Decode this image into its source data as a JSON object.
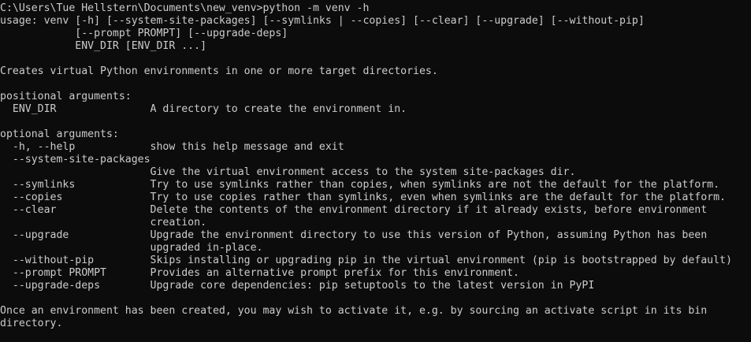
{
  "terminal": {
    "background": "#0c0c0c",
    "foreground": "#cccccc",
    "lines": [
      "C:\\Users\\Tue Hellstern\\Documents\\new_venv>python -m venv -h",
      "usage: venv [-h] [--system-site-packages] [--symlinks | --copies] [--clear] [--upgrade] [--without-pip]",
      "            [--prompt PROMPT] [--upgrade-deps]",
      "            ENV_DIR [ENV_DIR ...]",
      "",
      "Creates virtual Python environments in one or more target directories.",
      "",
      "positional arguments:",
      "  ENV_DIR               A directory to create the environment in.",
      "",
      "optional arguments:",
      "  -h, --help            show this help message and exit",
      "  --system-site-packages",
      "                        Give the virtual environment access to the system site-packages dir.",
      "  --symlinks            Try to use symlinks rather than copies, when symlinks are not the default for the platform.",
      "  --copies              Try to use copies rather than symlinks, even when symlinks are the default for the platform.",
      "  --clear               Delete the contents of the environment directory if it already exists, before environment",
      "                        creation.",
      "  --upgrade             Upgrade the environment directory to use this version of Python, assuming Python has been",
      "                        upgraded in-place.",
      "  --without-pip         Skips installing or upgrading pip in the virtual environment (pip is bootstrapped by default)",
      "  --prompt PROMPT       Provides an alternative prompt prefix for this environment.",
      "  --upgrade-deps        Upgrade core dependencies: pip setuptools to the latest version in PyPI",
      "",
      "Once an environment has been created, you may wish to activate it, e.g. by sourcing an activate script in its bin",
      "directory."
    ]
  }
}
